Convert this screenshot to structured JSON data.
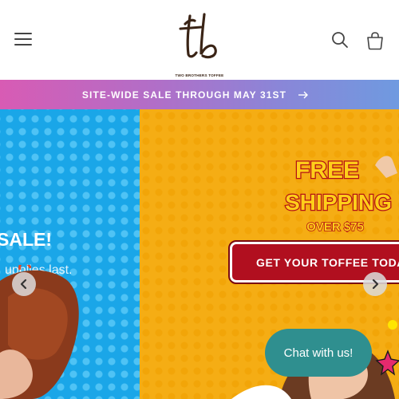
{
  "header": {
    "menu_icon": "hamburger-menu-icon",
    "logo_initials": "tb",
    "logo_text": "TWO BROTHERS TOFFEE",
    "search_icon": "search-icon",
    "cart_icon": "cart-icon"
  },
  "announcement": {
    "text": "SITE-WIDE SALE THROUGH MAY 31ST",
    "arrow_icon": "arrow-right-icon",
    "gradient": [
      "#d85bb4",
      "#b06fc8",
      "#8a86d8",
      "#6f9ae0"
    ]
  },
  "hero": {
    "slide_left": {
      "heading": "SALE!",
      "subtext": "upplies last.",
      "background": "#1aa6e8"
    },
    "slide_right": {
      "graphic_line1": "FREE",
      "graphic_line2": "SHIPPING",
      "graphic_line3": "OVER $75",
      "cta_label": "GET YOUR TOFFEE TODAY",
      "cta_color": "#b10f1f",
      "background": "#f5ad14"
    },
    "prev_icon": "chevron-left-icon",
    "next_icon": "chevron-right-icon"
  },
  "chat": {
    "label": "Chat with us!",
    "color": "#2f8f8f"
  }
}
